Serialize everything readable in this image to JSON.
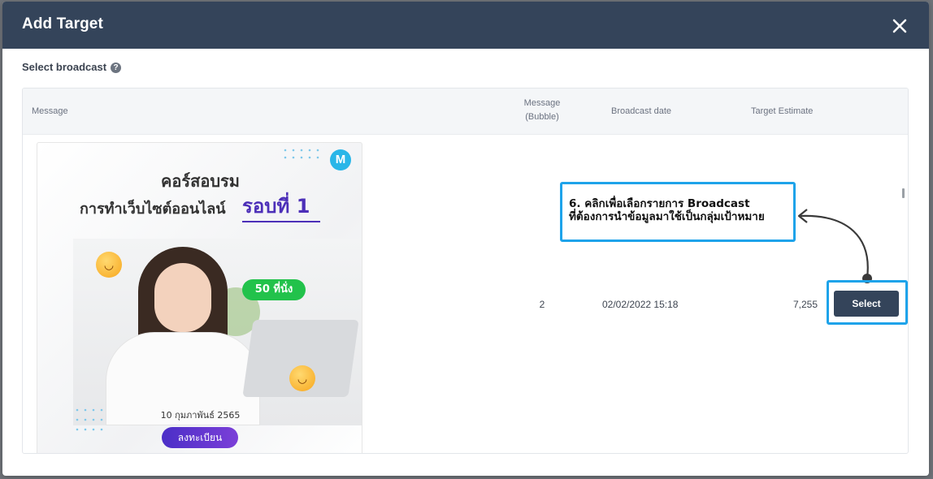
{
  "modal": {
    "title": "Add Target",
    "close_icon": "close-icon"
  },
  "section": {
    "label": "Select broadcast",
    "help_icon": "?"
  },
  "table": {
    "columns": {
      "message": "Message",
      "bubble_line1": "Message",
      "bubble_line2": "(Bubble)",
      "broadcast_date": "Broadcast date",
      "target_estimate": "Target Estimate"
    },
    "rows": [
      {
        "thumbnail": {
          "line1": "คอร์สอบรม",
          "line2": "การทำเว็บไซต์ออนไลน์",
          "line3": "รอบที่ 1",
          "seats": "50 ที่นั่ง",
          "date": "10 กุมภาพันธ์ 2565",
          "register": "ลงทะเบียน",
          "logo": "M"
        },
        "bubble": "2",
        "broadcast_date": "02/02/2022 15:18",
        "target_estimate": "7,255",
        "select_label": "Select"
      }
    ]
  },
  "callout": {
    "line1": "6. คลิกเพื่อเลือกรายการ Broadcast",
    "line2": "ที่ต้องการนำข้อมูลมาใช้เป็นกลุ่มเป้าหมาย"
  },
  "colors": {
    "header": "#34445a",
    "highlight": "#1ea3ea",
    "button": "#34445a"
  }
}
